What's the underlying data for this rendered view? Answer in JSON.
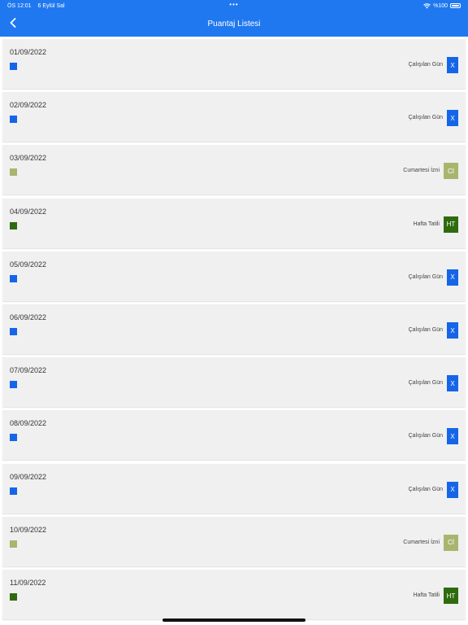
{
  "status_bar": {
    "time": "ÖS 12:01",
    "date": "6 Eylül Sal",
    "dots": "•••",
    "battery_text": "%100"
  },
  "nav": {
    "title": "Puantaj Listesi",
    "back_icon": "chevron-left-icon"
  },
  "colors": {
    "primary": "#1f78f0",
    "worked": "#1565e8",
    "saturday_leave": "#a8b56f",
    "weekend": "#2e6b0f"
  },
  "rows": [
    {
      "date": "01/09/2022",
      "label": "Çalışılan Gün",
      "code": "X",
      "color": "#1565e8"
    },
    {
      "date": "02/09/2022",
      "label": "Çalışılan Gün",
      "code": "X",
      "color": "#1565e8"
    },
    {
      "date": "03/09/2022",
      "label": "Cumartesi İzni",
      "code": "Cİ",
      "color": "#a8b56f"
    },
    {
      "date": "04/09/2022",
      "label": "Hafta Tatili",
      "code": "HT",
      "color": "#2e6b0f"
    },
    {
      "date": "05/09/2022",
      "label": "Çalışılan Gün",
      "code": "X",
      "color": "#1565e8"
    },
    {
      "date": "06/09/2022",
      "label": "Çalışılan Gün",
      "code": "X",
      "color": "#1565e8"
    },
    {
      "date": "07/09/2022",
      "label": "Çalışılan Gün",
      "code": "X",
      "color": "#1565e8"
    },
    {
      "date": "08/09/2022",
      "label": "Çalışılan Gün",
      "code": "X",
      "color": "#1565e8"
    },
    {
      "date": "09/09/2022",
      "label": "Çalışılan Gün",
      "code": "X",
      "color": "#1565e8"
    },
    {
      "date": "10/09/2022",
      "label": "Cumartesi İzni",
      "code": "Cİ",
      "color": "#a8b56f"
    },
    {
      "date": "11/09/2022",
      "label": "Hafta Tatili",
      "code": "HT",
      "color": "#2e6b0f"
    }
  ]
}
